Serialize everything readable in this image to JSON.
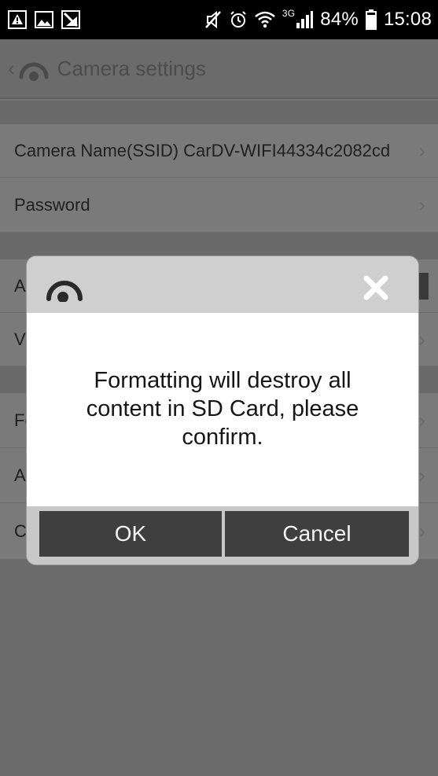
{
  "status_bar": {
    "network_type": "3G",
    "battery": "84%",
    "time": "15:08",
    "icons": [
      "warning-icon",
      "image-icon",
      "signal-strike-icon",
      "mute-icon",
      "alarm-icon",
      "wifi-icon",
      "cell-signal-icon",
      "battery-icon"
    ]
  },
  "app_bar": {
    "title": "Camera settings",
    "back_icon": "chevron-left-icon",
    "logo_icon": "camera-eye-icon"
  },
  "settings": {
    "rows": [
      {
        "label": "Camera Name(SSID) CarDV-WIFI44334c2082cd"
      },
      {
        "label": "Password"
      },
      {
        "label": "A"
      },
      {
        "label": "V"
      },
      {
        "label": "Fo"
      },
      {
        "label": "A"
      },
      {
        "label": "C"
      }
    ]
  },
  "dialog": {
    "message": "Formatting will destroy all content in SD Card, please confirm.",
    "ok_label": "OK",
    "cancel_label": "Cancel",
    "close_icon": "close-icon",
    "logo_icon": "camera-eye-icon"
  },
  "colors": {
    "status_bar_bg": "#000000",
    "overlay_bg": "#6b6b6b",
    "dialog_header_bg": "#cfcfcf",
    "dialog_body_bg": "#ffffff",
    "button_bg": "#3f3f3f",
    "button_text": "#f4f4f4"
  }
}
